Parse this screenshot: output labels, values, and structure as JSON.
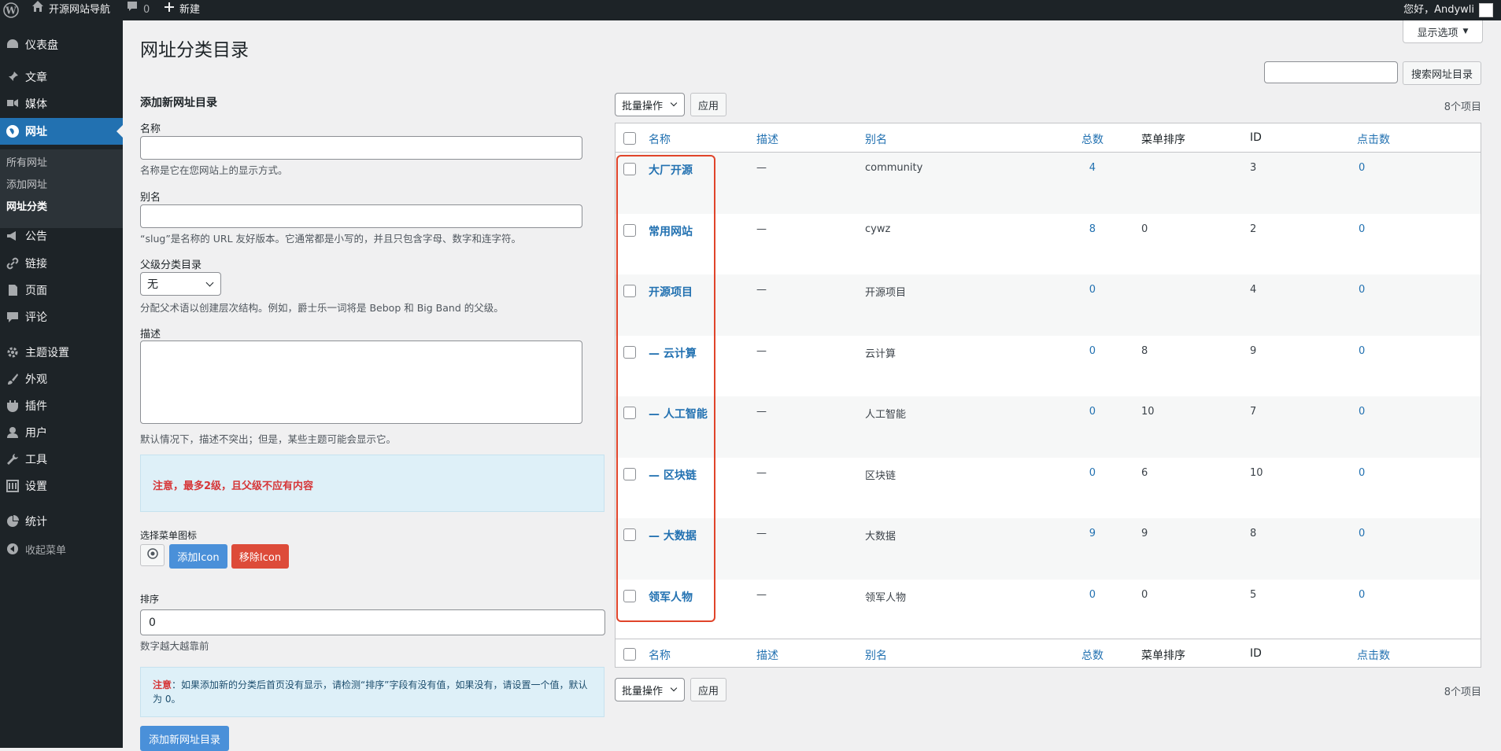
{
  "adminbar": {
    "site_name": "开源网站导航",
    "comments_count": "0",
    "new_label": "新建",
    "greeting": "您好，Andywli"
  },
  "sidebar": {
    "items": [
      {
        "label": "仪表盘",
        "icon": "dashboard-icon"
      },
      {
        "label": "文章",
        "icon": "pin-icon"
      },
      {
        "label": "媒体",
        "icon": "media-icon"
      },
      {
        "label": "网址",
        "icon": "globe-icon"
      },
      {
        "label": "公告",
        "icon": "megaphone-icon"
      },
      {
        "label": "链接",
        "icon": "link-icon"
      },
      {
        "label": "页面",
        "icon": "page-icon"
      },
      {
        "label": "评论",
        "icon": "comment-icon"
      },
      {
        "label": "主题设置",
        "icon": "gear-icon"
      },
      {
        "label": "外观",
        "icon": "brush-icon"
      },
      {
        "label": "插件",
        "icon": "plugin-icon"
      },
      {
        "label": "用户",
        "icon": "user-icon"
      },
      {
        "label": "工具",
        "icon": "wrench-icon"
      },
      {
        "label": "设置",
        "icon": "settings-icon"
      },
      {
        "label": "统计",
        "icon": "pie-chart-icon"
      }
    ],
    "submenu": [
      "所有网址",
      "添加网址",
      "网址分类"
    ],
    "collapse_label": "收起菜单"
  },
  "page": {
    "title": "网址分类目录",
    "screen_options": "显示选项",
    "search_button": "搜索网址目录"
  },
  "form": {
    "title": "添加新网址目录",
    "name_label": "名称",
    "name_hint": "名称是它在您网站上的显示方式。",
    "slug_label": "别名",
    "slug_hint": "“slug”是名称的 URL 友好版本。它通常都是小写的，并且只包含字母、数字和连字符。",
    "parent_label": "父级分类目录",
    "parent_value": "无",
    "parent_hint": "分配父术语以创建层次结构。例如，爵士乐一词将是 Bebop 和 Big Band 的父级。",
    "desc_label": "描述",
    "desc_hint": "默认情况下，描述不突出；但是，某些主题可能会显示它。",
    "notice1": "注意，最多2级，且父级不应有内容",
    "icon_label": "选择菜单图标",
    "add_icon": "添加Icon",
    "remove_icon": "移除Icon",
    "order_label": "排序",
    "order_value": "0",
    "order_hint": "数字越大越靠前",
    "notice2_prefix": "注意",
    "notice2_text": "：如果添加新的分类后首页没有显示，请检测“排序”字段有没有值，如果没有，请设置一个值，默认",
    "notice2_text2": "为 0。",
    "submit": "添加新网址目录"
  },
  "list": {
    "bulk_label": "批量操作",
    "apply_label": "应用",
    "items_count": "8个项目",
    "columns": [
      "名称",
      "描述",
      "别名",
      "总数",
      "菜单排序",
      "ID",
      "点击数"
    ],
    "rows": [
      {
        "name": "大厂开源",
        "desc": "—",
        "slug": "community",
        "count": "4",
        "order": "",
        "id": "3",
        "clicks": "0"
      },
      {
        "name": "常用网站",
        "desc": "—",
        "slug": "cywz",
        "count": "8",
        "order": "0",
        "id": "2",
        "clicks": "0"
      },
      {
        "name": "开源项目",
        "desc": "—",
        "slug": "开源项目",
        "count": "0",
        "order": "",
        "id": "4",
        "clicks": "0"
      },
      {
        "name": "— 云计算",
        "desc": "—",
        "slug": "云计算",
        "count": "0",
        "order": "8",
        "id": "9",
        "clicks": "0"
      },
      {
        "name": "— 人工智能",
        "desc": "—",
        "slug": "人工智能",
        "count": "0",
        "order": "10",
        "id": "7",
        "clicks": "0"
      },
      {
        "name": "— 区块链",
        "desc": "—",
        "slug": "区块链",
        "count": "0",
        "order": "6",
        "id": "10",
        "clicks": "0"
      },
      {
        "name": "— 大数据",
        "desc": "—",
        "slug": "大数据",
        "count": "9",
        "order": "9",
        "id": "8",
        "clicks": "0"
      },
      {
        "name": "领军人物",
        "desc": "—",
        "slug": "领军人物",
        "count": "0",
        "order": "0",
        "id": "5",
        "clicks": "0"
      }
    ]
  },
  "colors": {
    "accent": "#2271b1",
    "highlight": "#e0442a",
    "admin_bg": "#1d2327"
  }
}
